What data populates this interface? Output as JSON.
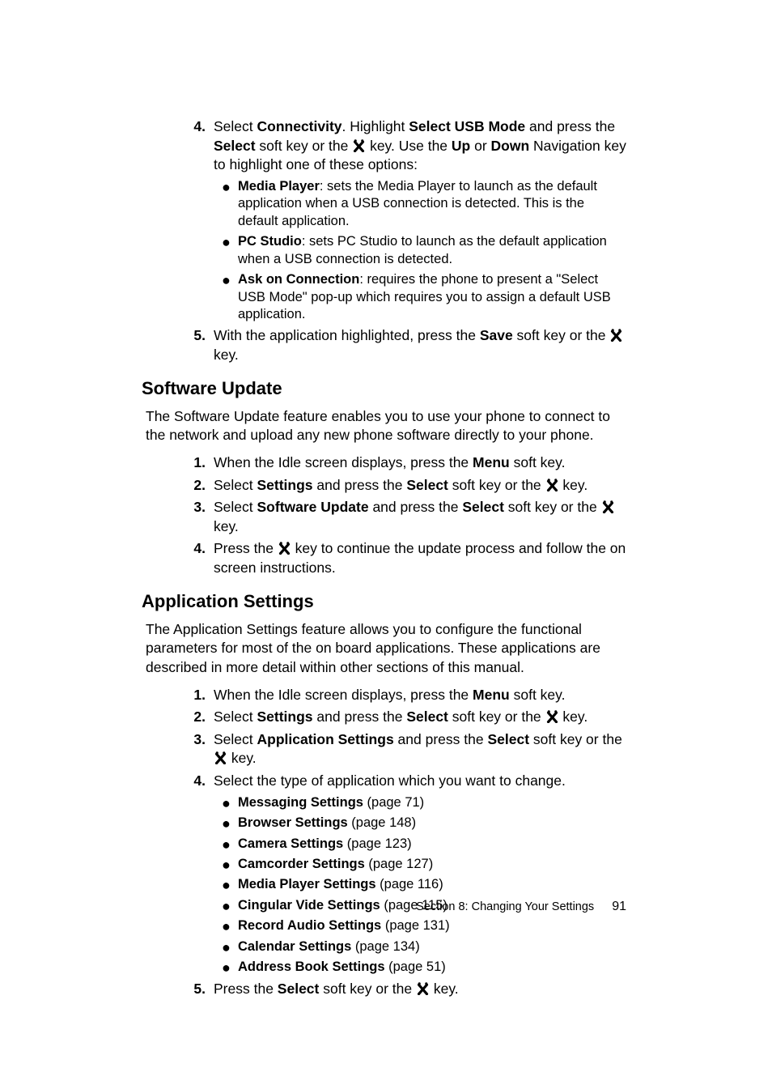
{
  "step4": {
    "num": "4.",
    "pre": "Select ",
    "connectivity": "Connectivity",
    "mid1": ". Highlight ",
    "usbmode": "Select USB Mode",
    "mid2": " and press the ",
    "select": "Select",
    "mid3": " soft key or the ",
    "mid4": " key. Use the ",
    "up": "Up",
    "or": " or ",
    "down": "Down",
    "tail": " Navigation key to highlight one of these options:"
  },
  "step4_bullets": [
    {
      "b": "Media Player",
      "t": ": sets the Media Player to launch as the default application when a USB connection is detected. This is the default application."
    },
    {
      "b": "PC Studio",
      "t": ": sets PC Studio to launch as the default application when a USB connection is detected."
    },
    {
      "b": "Ask on Connection",
      "t": ": requires the phone to present a \"Select USB Mode\" pop-up which requires you to assign a default USB application."
    }
  ],
  "step5": {
    "num": "5.",
    "pre": "With the application highlighted, press the ",
    "save": "Save",
    "mid": " soft key or the ",
    "tail": " key."
  },
  "sw_heading": "Software Update",
  "sw_para": "The Software Update feature enables you to use your phone to connect to the network and upload any new phone software directly to your phone.",
  "sw_steps": {
    "s1": {
      "num": "1.",
      "pre": "When the Idle screen displays, press the ",
      "b": "Menu",
      "tail": " soft key."
    },
    "s2": {
      "num": "2.",
      "pre": "Select ",
      "b1": "Settings",
      "mid": " and press the ",
      "b2": "Select",
      "mid2": " soft key or the ",
      "tail": " key."
    },
    "s3": {
      "num": "3.",
      "pre": "Select ",
      "b1": "Software Update",
      "mid": " and press the ",
      "b2": "Select",
      "mid2": " soft key or the ",
      "tail": " key."
    },
    "s4": {
      "num": "4.",
      "pre": "Press the ",
      "tail": " key to continue the update process and follow the on screen instructions."
    }
  },
  "app_heading": "Application Settings",
  "app_para": "The Application Settings feature allows you to configure the functional parameters for most of the on board applications. These applications are described in more detail within other sections of this manual.",
  "app_s1": {
    "num": "1.",
    "pre": "When the Idle screen displays, press the ",
    "b": "Menu",
    "tail": " soft key."
  },
  "app_s2": {
    "num": "2.",
    "pre": "Select ",
    "b1": "Settings",
    "mid": " and press the ",
    "b2": "Select",
    "mid2": " soft key or the ",
    "tail": " key."
  },
  "app_s3": {
    "num": "3.",
    "pre": "Select ",
    "b1": "Application Settings",
    "mid": " and press the ",
    "b2": "Select",
    "mid2": " soft key or the ",
    "tail": " key."
  },
  "app_s4": {
    "num": "4.",
    "t": "Select the type of application which you want to change."
  },
  "app_bullets": [
    {
      "b": "Messaging Settings",
      "t": " (page 71)"
    },
    {
      "b": "Browser Settings",
      "t": " (page 148)"
    },
    {
      "b": "Camera Settings",
      "t": " (page 123)"
    },
    {
      "b": "Camcorder Settings",
      "t": " (page 127)"
    },
    {
      "b": "Media Player Settings",
      "t": " (page 116)"
    },
    {
      "b": "Cingular Vide Settings",
      "t": " (page 115)"
    },
    {
      "b": "Record Audio Settings",
      "t": " (page 131)"
    },
    {
      "b": "Calendar Settings",
      "t": " (page 134)"
    },
    {
      "b": "Address Book Settings",
      "t": " (page 51)"
    }
  ],
  "app_s5": {
    "num": "5.",
    "pre": "Press the ",
    "b": "Select",
    "mid": " soft key or the ",
    "tail": " key."
  },
  "footer": {
    "section": "Section 8: Changing Your Settings",
    "page": "91"
  }
}
